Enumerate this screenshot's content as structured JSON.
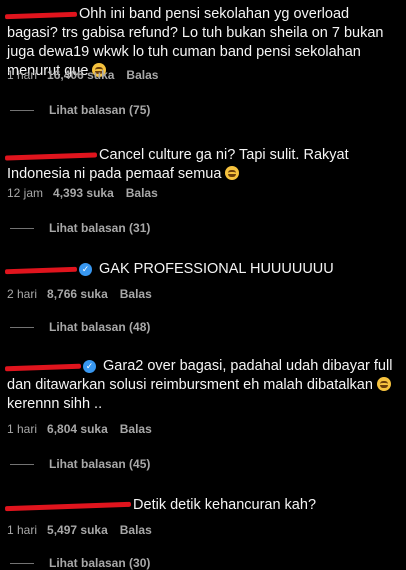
{
  "comments": [
    {
      "username": "••••••••••",
      "verified": false,
      "text": "Ohh ini band pensi sekolahan yg overload bagasi? trs gabisa refund? Lo tuh bukan sheila on 7 bukan juga dewa19 wkwk lo tuh cuman band pensi sekolahan menurut gue",
      "emoji": "grinning-sweat",
      "time": "1 hari",
      "likes": "16,406 suka",
      "reply": "Balas",
      "view_replies": "Lihat balasan (75)"
    },
    {
      "username": "•••••••••••",
      "verified": false,
      "text": "Cancel culture ga ni? Tapi sulit. Rakyat Indonesia ni pada pemaaf semua",
      "emoji": "rofl",
      "time": "12 jam",
      "likes": "4,393 suka",
      "reply": "Balas",
      "view_replies": "Lihat balasan (31)"
    },
    {
      "username": "••••••••",
      "verified": true,
      "text": "GAK PROFESSIONAL HUUUUUUU",
      "emoji": "",
      "time": "2 hari",
      "likes": "8,766 suka",
      "reply": "Balas",
      "view_replies": "Lihat balasan (48)"
    },
    {
      "username": "••••••••_",
      "verified": true,
      "text": "Gara2 over bagasi, padahal udah dibayar full dan ditawarkan solusi reimbursment eh malah dibatalkan",
      "text_tail": "kerennn sihh ..",
      "emoji": "grinning-sweat",
      "time": "1 hari",
      "likes": "6,804 suka",
      "reply": "Balas",
      "view_replies": "Lihat balasan (45)"
    },
    {
      "username": "••••••••••••••••",
      "verified": false,
      "text": "Detik detik kehancuran kah?",
      "emoji": "",
      "time": "1 hari",
      "likes": "5,497 suka",
      "reply": "Balas",
      "view_replies": "Lihat balasan (30)"
    }
  ]
}
